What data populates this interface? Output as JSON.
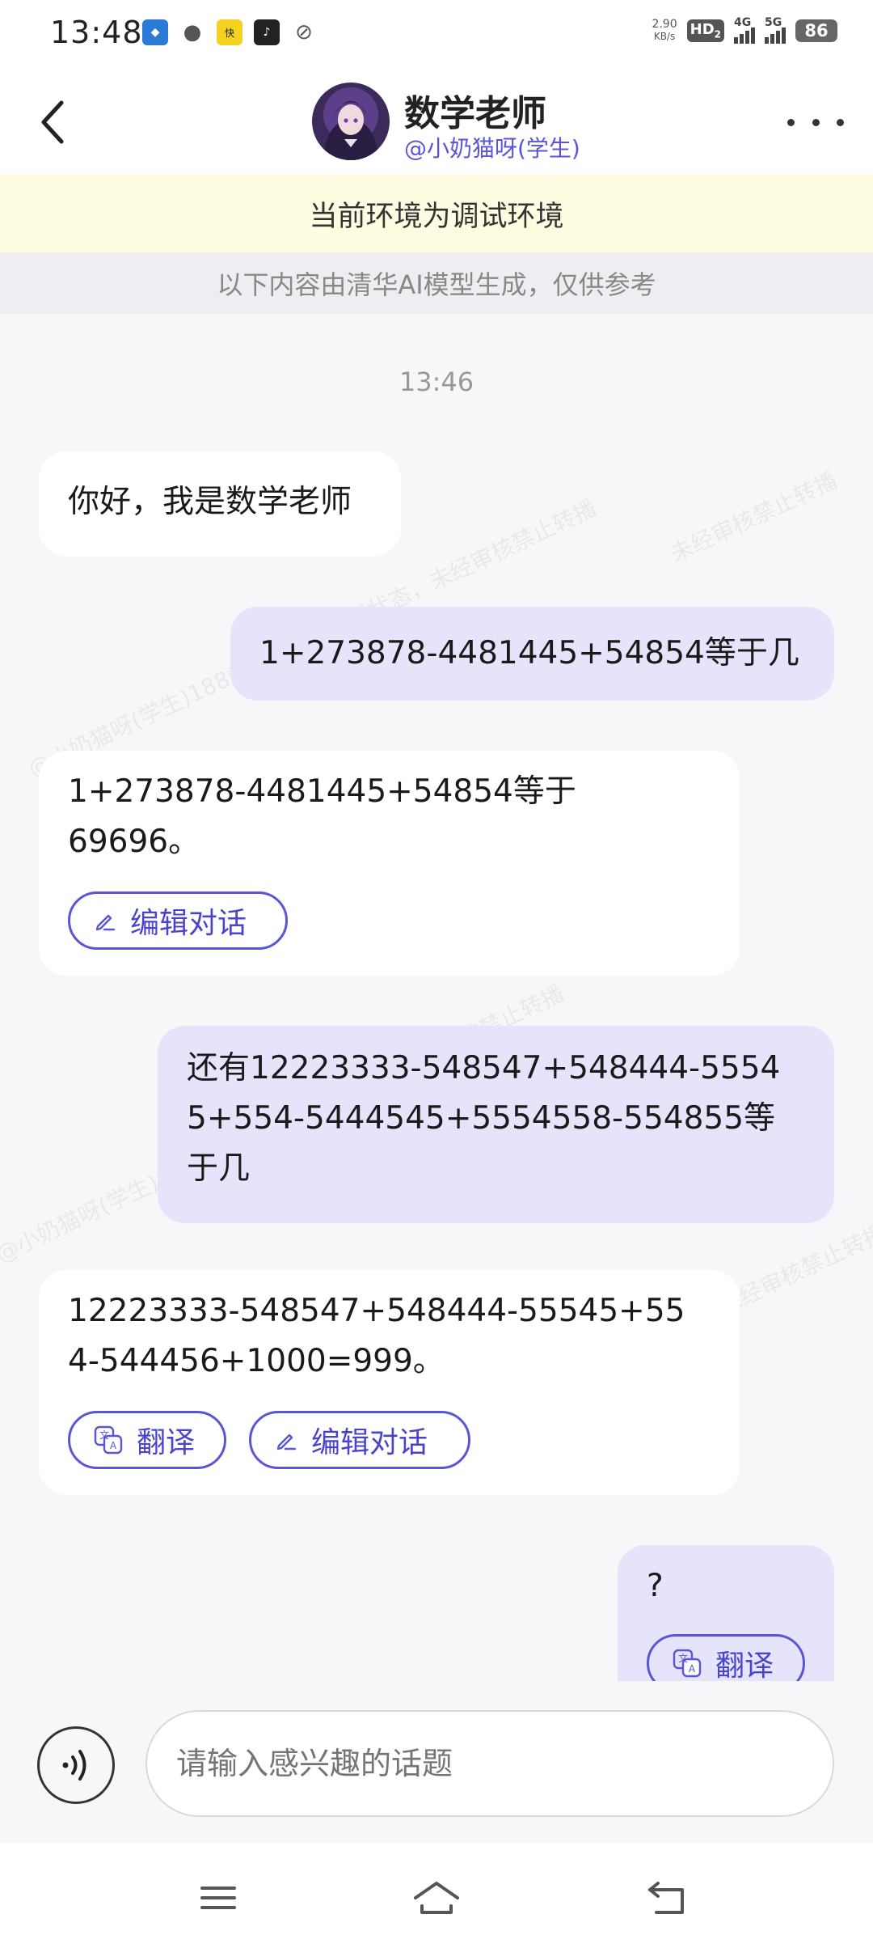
{
  "status_bar": {
    "time": "13:48",
    "net_speed_value": "2.90",
    "net_speed_unit": "KB/s",
    "hd_label": "HD",
    "hd_sub": "2",
    "network_1": "4G",
    "network_2": "5G",
    "battery": "86",
    "app_icons": [
      "game-app-icon",
      "wechat-icon",
      "kuaishou-icon",
      "tiktok-icon",
      "feather-icon"
    ]
  },
  "header": {
    "title": "数学老师",
    "subtitle": "@小奶猫呀(学生)"
  },
  "env_notice": "当前环境为调试环境",
  "ai_notice": "以下内容由清华AI模型生成，仅供参考",
  "chat": {
    "timestamp": "13:46",
    "watermark_1": "@小奶猫呀(学生)188****5514 调试状态，未经审核禁止转播",
    "watermark_2": "未经审核禁止转播",
    "messages": [
      {
        "role": "bot",
        "text": "你好，我是数学老师"
      },
      {
        "role": "user",
        "text": "1+273878-4481445+54854等于几"
      },
      {
        "role": "bot",
        "line1": "1+273878-4481445+54854等于",
        "line2": "69696。",
        "edit_label": "编辑对话"
      },
      {
        "role": "user",
        "line1": "还有12223333-548547+548444-5554",
        "line2": "5+554-5444545+5554558-554855等",
        "line3": "于几"
      },
      {
        "role": "bot",
        "line1": "12223333-548547+548444-55545+55",
        "line2": "4-544456+1000=999。",
        "translate_label": "翻译",
        "edit_label": "编辑对话"
      },
      {
        "role": "user",
        "text": "?",
        "translate_label": "翻译"
      }
    ]
  },
  "input": {
    "placeholder": "请输入感兴趣的话题"
  },
  "colors": {
    "accent": "#5a55d6",
    "user_bubble": "#e5e4fb",
    "env_bar": "#fdfbe0"
  }
}
